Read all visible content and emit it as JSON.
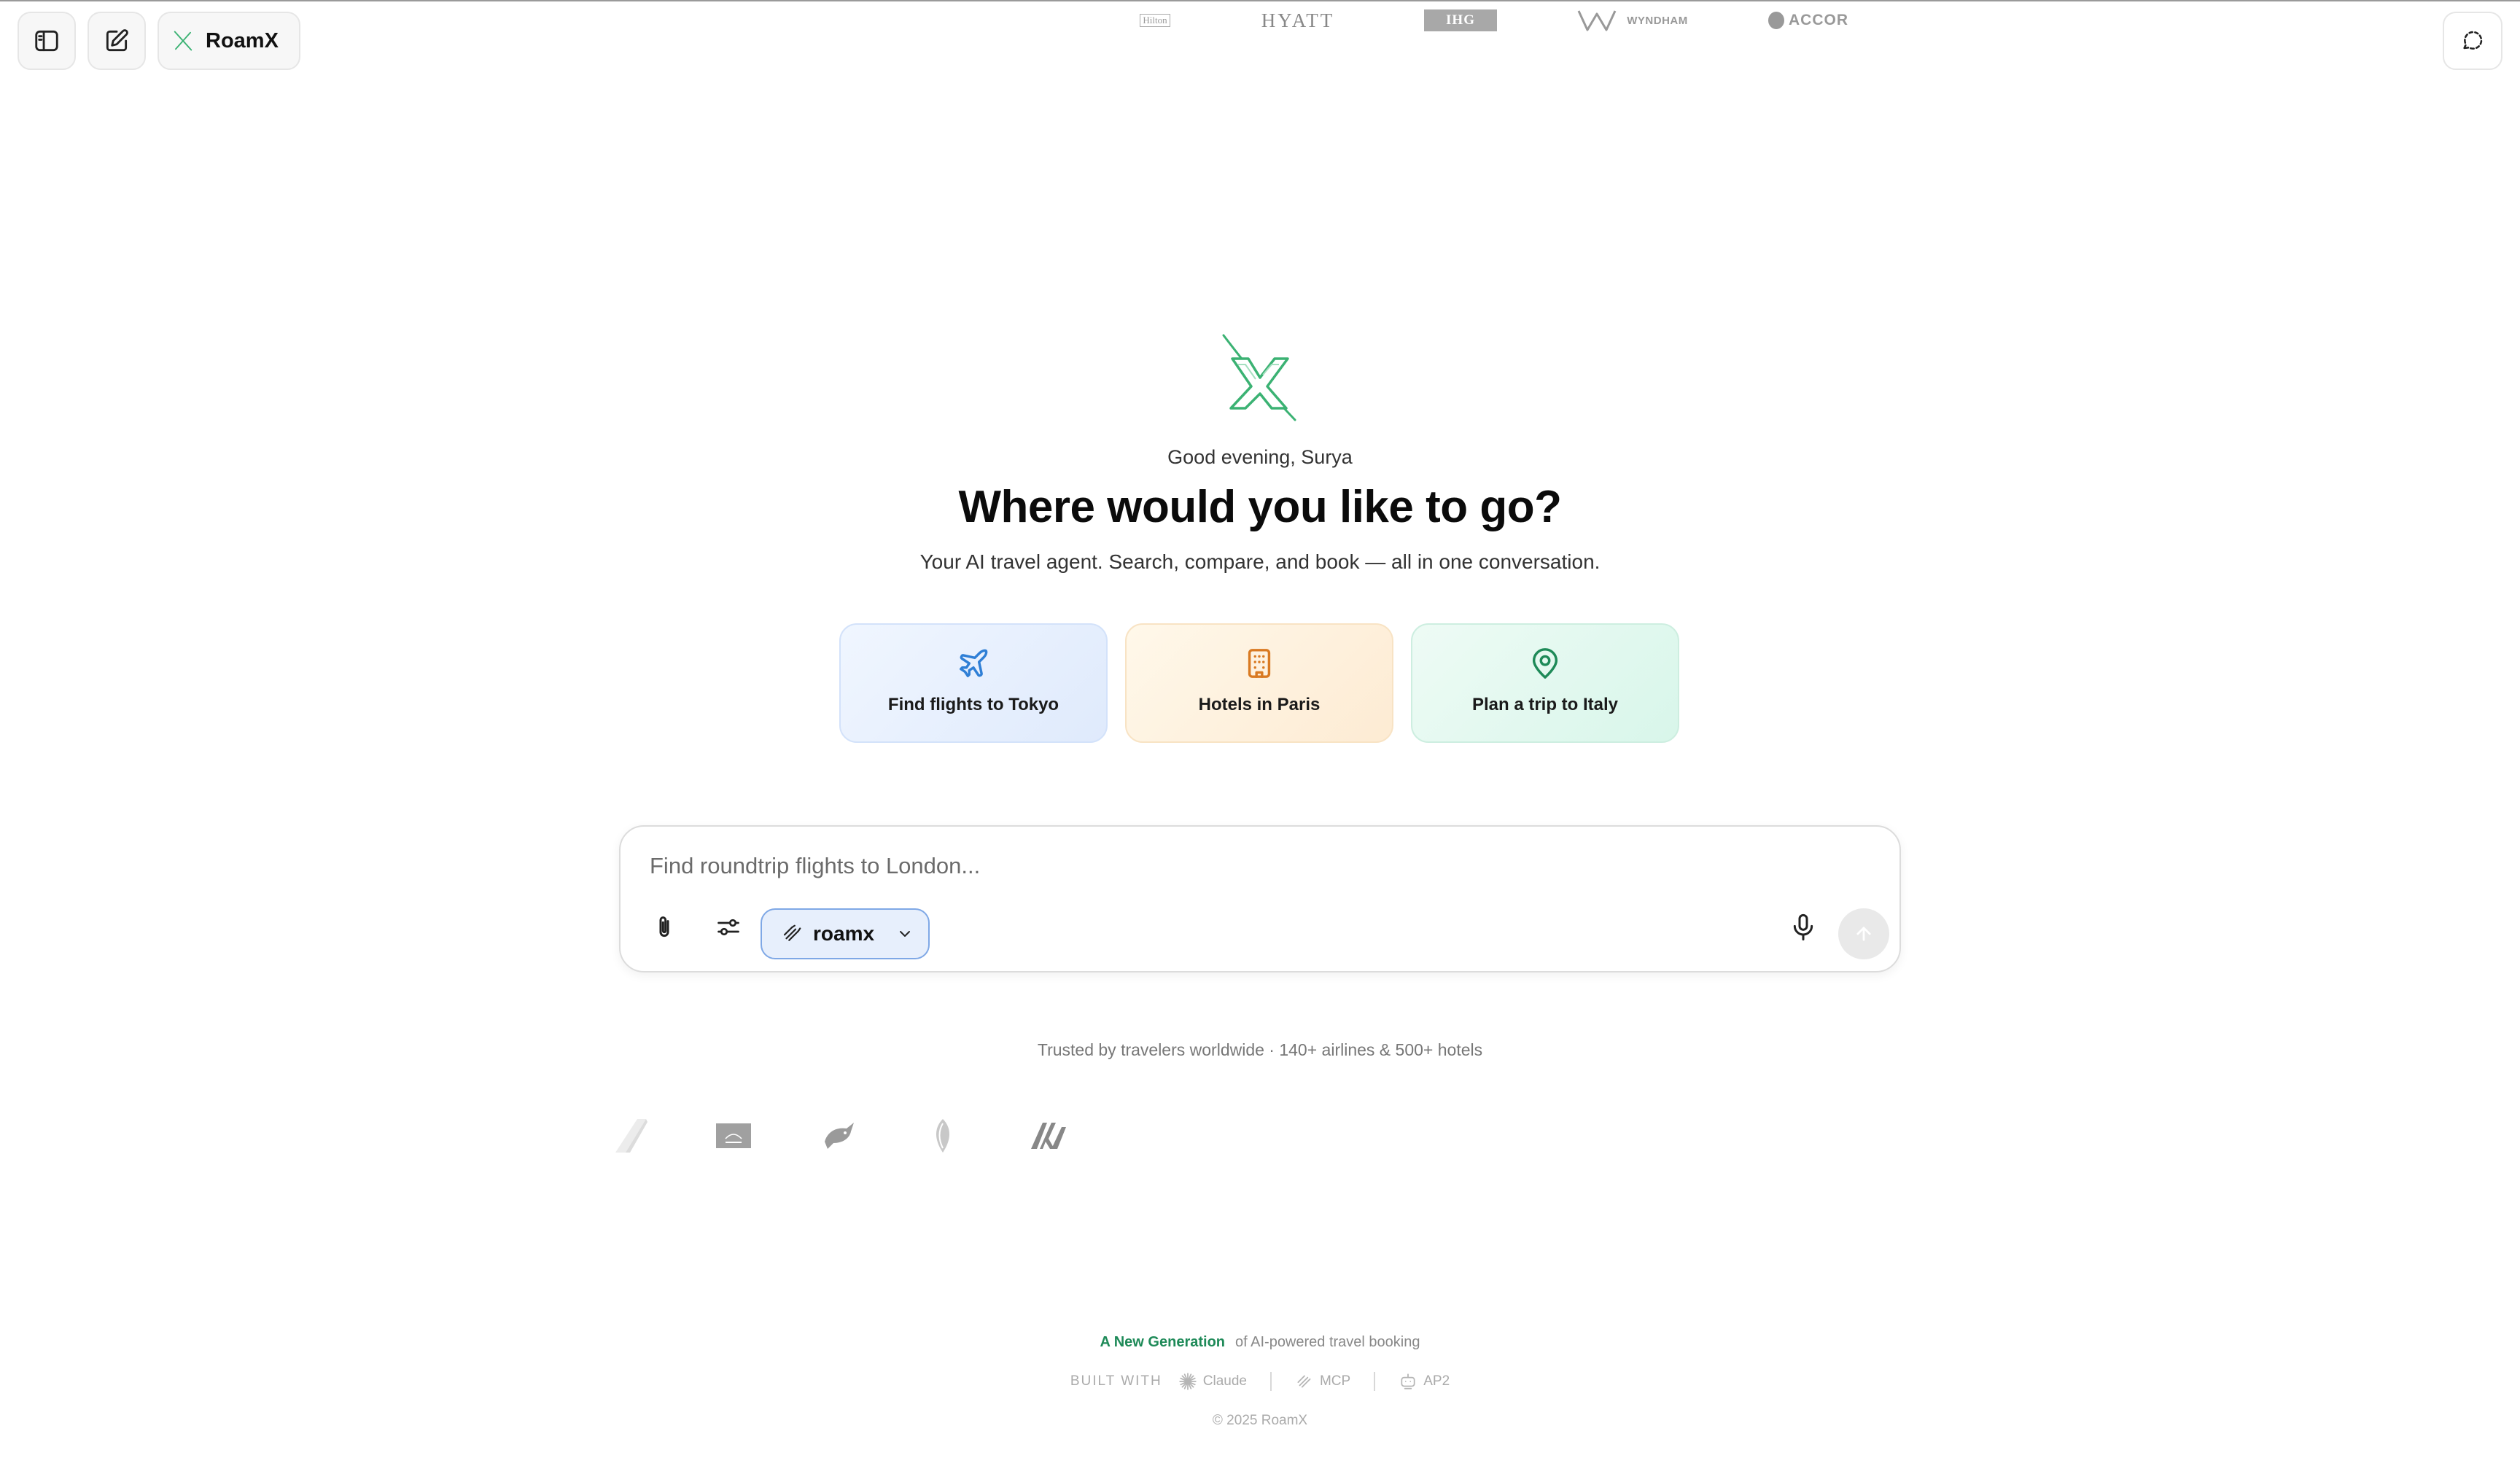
{
  "header": {
    "brand_label": "RoamX"
  },
  "hero": {
    "greeting": "Good evening, Surya",
    "headline": "Where would you like to go?",
    "subtitle": "Your AI travel agent. Search, compare, and book — all in one conversation."
  },
  "suggestions": [
    {
      "label": "Find flights to Tokyo",
      "icon": "plane-icon",
      "color": "#2f7fd6"
    },
    {
      "label": "Hotels in Paris",
      "icon": "building-icon",
      "color": "#d97a22"
    },
    {
      "label": "Plan a trip to Italy",
      "icon": "map-pin-icon",
      "color": "#1e8a58"
    }
  ],
  "composer": {
    "placeholder": "Find roundtrip flights to London...",
    "model_label": "roamx"
  },
  "trust": {
    "text": "Trusted by travelers worldwide · 140+ airlines & 500+ hotels",
    "logos": [
      "Hilton",
      "HYATT",
      "IHG",
      "WYNDHAM",
      "ACCOR"
    ]
  },
  "footer": {
    "tag_accent": "A New Generation",
    "tag_rest": "of AI-powered travel booking",
    "built_with": "BUILT WITH",
    "built_items": [
      "Claude",
      "MCP",
      "AP2"
    ],
    "copyright": "© 2025 RoamX"
  },
  "colors": {
    "brand_green": "#1e8a58",
    "model_chip_bg": "#e7effc",
    "model_chip_border": "#7fa8e6"
  }
}
